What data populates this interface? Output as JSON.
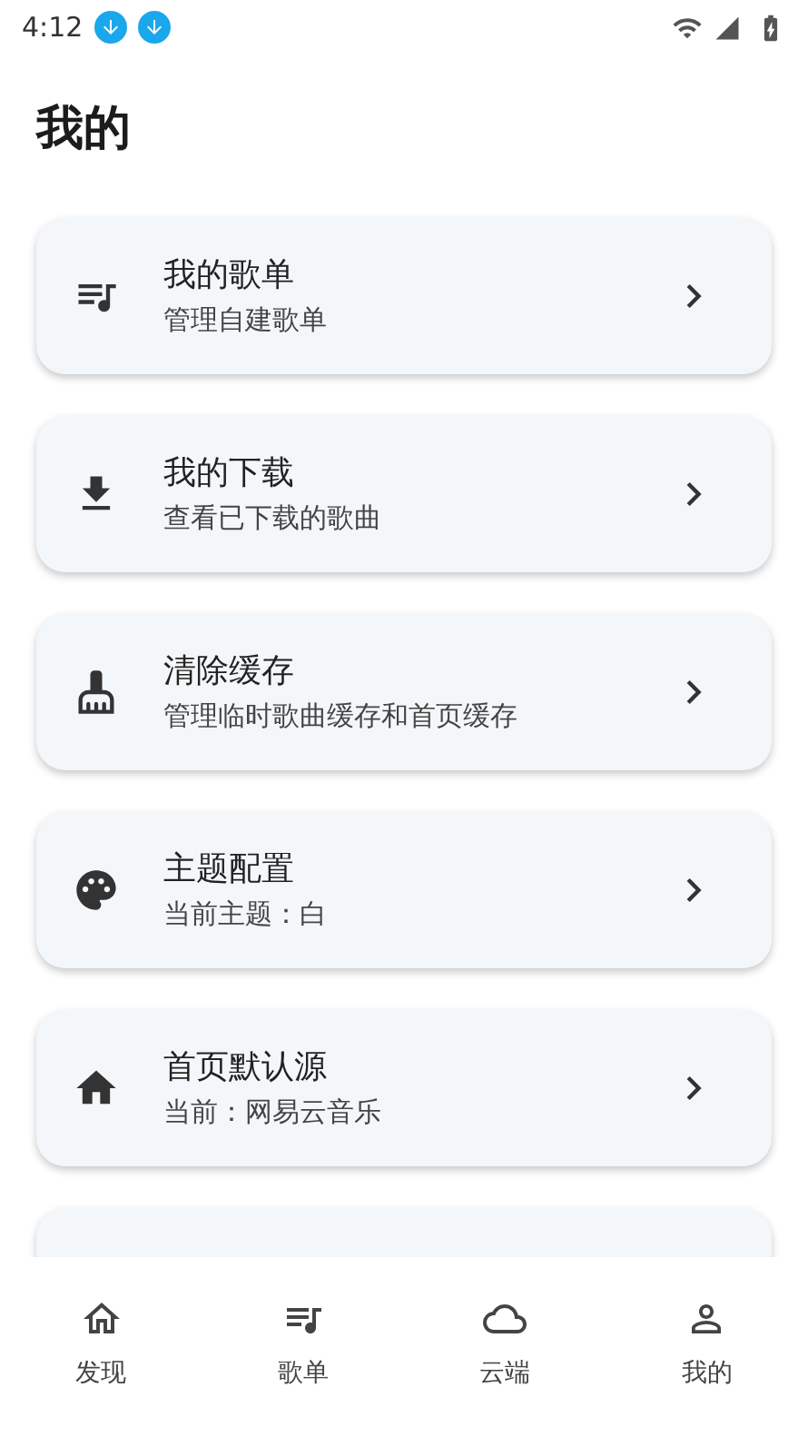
{
  "status_bar": {
    "time": "4:12"
  },
  "title": "我的",
  "items": [
    {
      "title": "我的歌单",
      "subtitle": "管理自建歌单"
    },
    {
      "title": "我的下载",
      "subtitle": "查看已下载的歌曲"
    },
    {
      "title": "清除缓存",
      "subtitle": "管理临时歌曲缓存和首页缓存"
    },
    {
      "title": "主题配置",
      "subtitle": "当前主题：白"
    },
    {
      "title": "首页默认源",
      "subtitle": "当前：网易云音乐"
    }
  ],
  "nav": [
    {
      "label": "发现"
    },
    {
      "label": "歌单"
    },
    {
      "label": "云端"
    },
    {
      "label": "我的"
    }
  ]
}
